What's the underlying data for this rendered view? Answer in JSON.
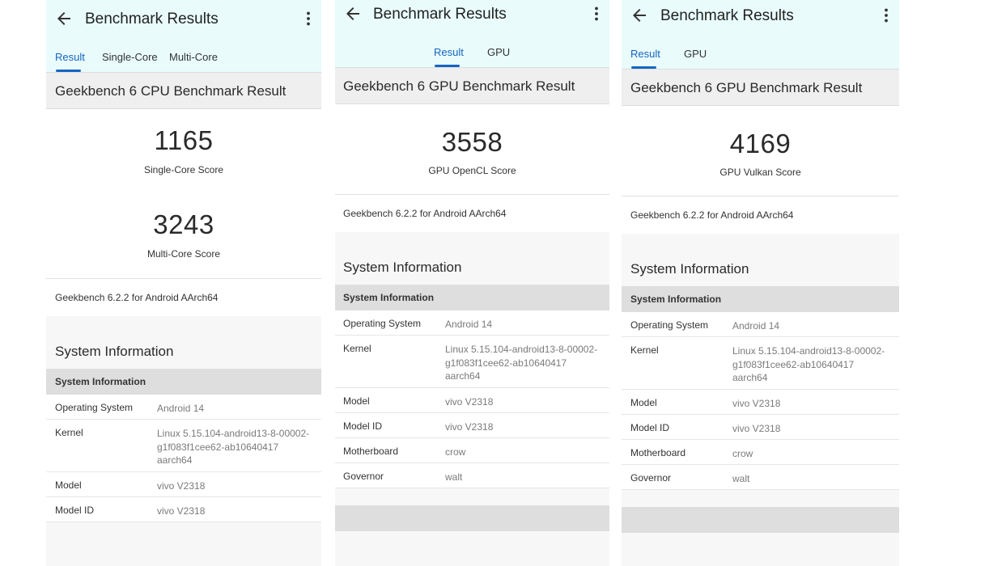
{
  "screens": [
    {
      "appbar_title": "Benchmark Results",
      "tabs": [
        "Result",
        "Single-Core",
        "Multi-Core"
      ],
      "result_title": "Geekbench 6 CPU Benchmark Result",
      "scores": [
        {
          "value": "1165",
          "label": "Single-Core Score"
        },
        {
          "value": "3243",
          "label": "Multi-Core Score"
        }
      ],
      "version": "Geekbench 6.2.2 for Android AArch64",
      "sysinfo_title": "System Information",
      "table_header": "System Information",
      "rows": [
        {
          "key": "Operating System",
          "value": "Android 14"
        },
        {
          "key": "Kernel",
          "value": "Linux 5.15.104-android13-8-00002-g1f083f1cee62-ab10640417 aarch64"
        },
        {
          "key": "Model",
          "value": "vivo V2318"
        },
        {
          "key": "Model ID",
          "value": "vivo V2318"
        }
      ]
    },
    {
      "appbar_title": "Benchmark Results",
      "tabs": [
        "Result",
        "GPU"
      ],
      "result_title": "Geekbench 6 GPU Benchmark Result",
      "scores": [
        {
          "value": "3558",
          "label": "GPU OpenCL Score"
        }
      ],
      "version": "Geekbench 6.2.2 for Android AArch64",
      "sysinfo_title": "System Information",
      "table_header": "System Information",
      "rows": [
        {
          "key": "Operating System",
          "value": "Android 14"
        },
        {
          "key": "Kernel",
          "value": "Linux 5.15.104-android13-8-00002-g1f083f1cee62-ab10640417 aarch64"
        },
        {
          "key": "Model",
          "value": "vivo V2318"
        },
        {
          "key": "Model ID",
          "value": "vivo V2318"
        },
        {
          "key": "Motherboard",
          "value": "crow"
        },
        {
          "key": "Governor",
          "value": "walt"
        }
      ]
    },
    {
      "appbar_title": "Benchmark Results",
      "tabs": [
        "Result",
        "GPU"
      ],
      "result_title": "Geekbench 6 GPU Benchmark Result",
      "scores": [
        {
          "value": "4169",
          "label": "GPU Vulkan Score"
        }
      ],
      "version": "Geekbench 6.2.2 for Android AArch64",
      "sysinfo_title": "System Information",
      "table_header": "System Information",
      "rows": [
        {
          "key": "Operating System",
          "value": "Android 14"
        },
        {
          "key": "Kernel",
          "value": "Linux 5.15.104-android13-8-00002-g1f083f1cee62-ab10640417 aarch64"
        },
        {
          "key": "Model",
          "value": "vivo V2318"
        },
        {
          "key": "Model ID",
          "value": "vivo V2318"
        },
        {
          "key": "Motherboard",
          "value": "crow"
        },
        {
          "key": "Governor",
          "value": "walt"
        }
      ]
    }
  ],
  "icons": {
    "back": "arrow-back-icon",
    "more": "more-vert-icon"
  },
  "colors": {
    "appbar_bg": "#e9fbfb",
    "accent": "#1565c0",
    "section_bg": "#efefef",
    "table_head_bg": "#dedede"
  }
}
